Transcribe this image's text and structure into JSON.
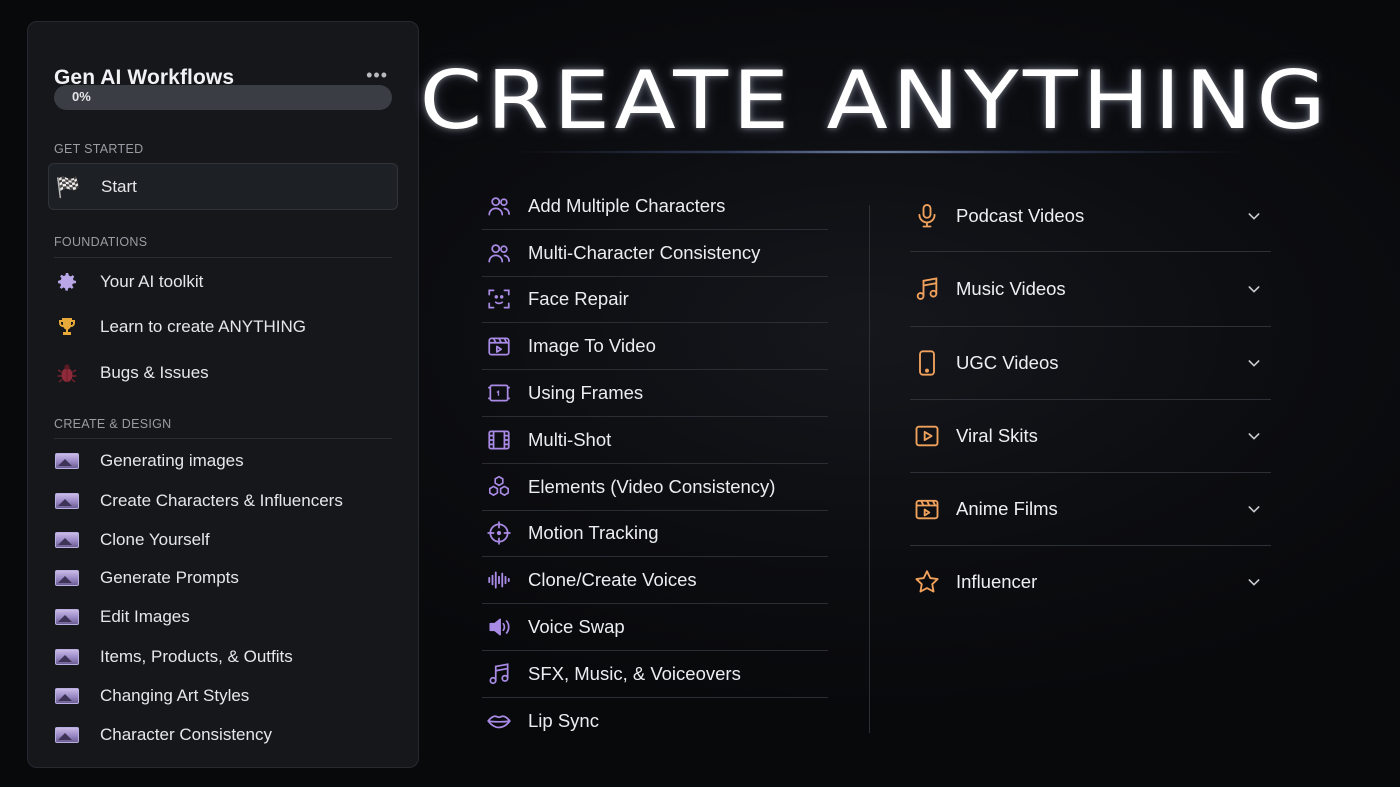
{
  "sidebar": {
    "title": "Gen AI Workflows",
    "more_label": "•••",
    "progress": {
      "label": "0%",
      "value": 0
    },
    "sections": {
      "get_started": "GET STARTED",
      "foundations": "FOUNDATIONS",
      "create_design": "CREATE & DESIGN"
    },
    "start": {
      "label": "Start",
      "icon": "checkered-flag-icon",
      "glyph": "🏁"
    },
    "foundations_items": [
      {
        "label": "Your AI toolkit",
        "icon": "gear-icon",
        "glyph": "⚙️"
      },
      {
        "label": "Learn to create ANYTHING",
        "icon": "trophy-icon",
        "glyph": "🏆"
      },
      {
        "label": "Bugs & Issues",
        "icon": "beetle-icon",
        "glyph": "🪲"
      }
    ],
    "create_items": [
      {
        "label": "Generating images",
        "icon": "image-thumbnail-icon"
      },
      {
        "label": "Create Characters & Influencers",
        "icon": "image-thumbnail-icon"
      },
      {
        "label": "Clone Yourself",
        "icon": "image-thumbnail-icon"
      },
      {
        "label": "Generate Prompts",
        "icon": "image-thumbnail-icon"
      },
      {
        "label": "Edit Images",
        "icon": "image-thumbnail-icon"
      },
      {
        "label": "Items, Products, & Outfits",
        "icon": "image-thumbnail-icon"
      },
      {
        "label": "Changing Art Styles",
        "icon": "image-thumbnail-icon"
      },
      {
        "label": "Character Consistency",
        "icon": "image-thumbnail-icon"
      }
    ]
  },
  "main": {
    "headline": "CREATE ANYTHING",
    "feature_items": [
      {
        "label": "Add Multiple Characters",
        "icon": "users-icon"
      },
      {
        "label": "Multi-Character Consistency",
        "icon": "users-icon"
      },
      {
        "label": "Face Repair",
        "icon": "face-scan-icon"
      },
      {
        "label": "Image To Video",
        "icon": "clapperboard-icon"
      },
      {
        "label": "Using Frames",
        "icon": "frame-icon"
      },
      {
        "label": "Multi-Shot",
        "icon": "film-strip-icon"
      },
      {
        "label": "Elements (Video Consistency)",
        "icon": "hexagons-icon"
      },
      {
        "label": "Motion Tracking",
        "icon": "crosshair-icon"
      },
      {
        "label": "Clone/Create Voices",
        "icon": "waveform-icon"
      },
      {
        "label": "Voice Swap",
        "icon": "speaker-icon"
      },
      {
        "label": "SFX, Music, & Voiceovers",
        "icon": "music-note-icon"
      },
      {
        "label": "Lip Sync",
        "icon": "lips-icon"
      }
    ],
    "categories": [
      {
        "label": "Podcast Videos",
        "icon": "microphone-icon"
      },
      {
        "label": "Music Videos",
        "icon": "music-note-icon"
      },
      {
        "label": "UGC Videos",
        "icon": "smartphone-icon"
      },
      {
        "label": "Viral Skits",
        "icon": "play-box-icon"
      },
      {
        "label": "Anime Films",
        "icon": "clapperboard-icon"
      },
      {
        "label": "Influencer",
        "icon": "star-icon"
      }
    ]
  },
  "colors": {
    "accent_purple": "#a98be6",
    "accent_orange": "#f0a15c",
    "background": "#0b0c0f",
    "panel": "#15171b"
  }
}
